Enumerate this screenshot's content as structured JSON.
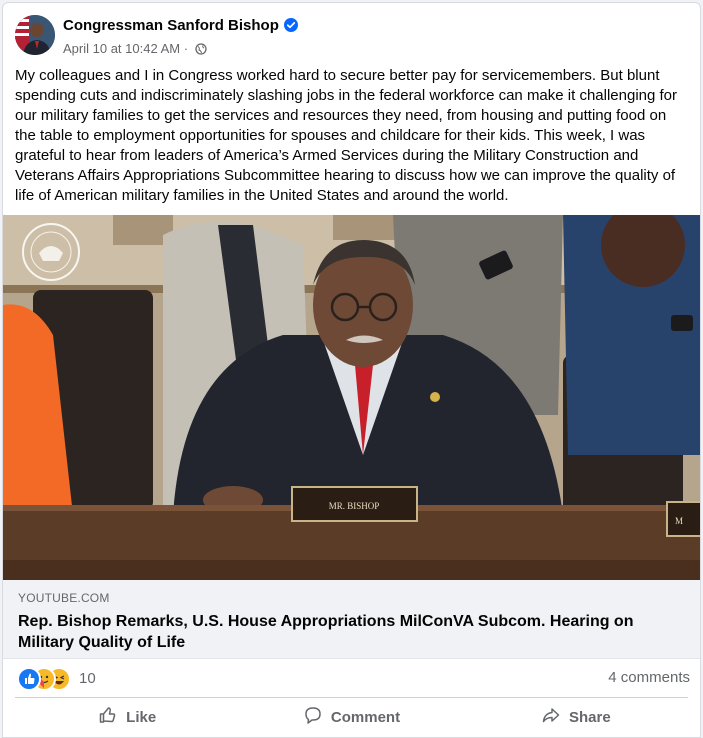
{
  "post": {
    "author": "Congressman Sanford Bishop",
    "timestamp": "April 10 at 10:42 AM",
    "separator": "·",
    "privacy_icon": "globe-icon",
    "verified_icon": "verified-badge-icon",
    "text": "My colleagues and I in Congress worked hard to secure better pay for servicemembers. But blunt spending cuts and indiscriminately slashing jobs in the federal workforce can make it challenging for our military families to get the services and resources they need, from housing and putting food on the table to employment opportunities for spouses and childcare for their kids. This week, I was grateful to hear from leaders of America’s Armed Services during the Military Construction and Veterans Affairs Appropriations Subcommittee hearing to discuss how we can improve the quality of life of American military families in the United States and around the world."
  },
  "media": {
    "nameplate": "MR. BISHOP",
    "nameplate_partial": "M"
  },
  "link": {
    "domain": "YOUTUBE.COM",
    "title": "Rep. Bishop Remarks, U.S. House Appropriations MilConVA Subcom. Hearing on Military Quality of Life"
  },
  "reactions": {
    "icons": [
      "like-reaction-icon",
      "care-reaction-icon",
      "haha-reaction-icon"
    ],
    "count": "10",
    "comments": "4 comments"
  },
  "actions": {
    "like": "Like",
    "comment": "Comment",
    "share": "Share"
  },
  "colors": {
    "accent": "#0866ff",
    "secondary_text": "#65676b",
    "background": "#f0f2f5"
  }
}
